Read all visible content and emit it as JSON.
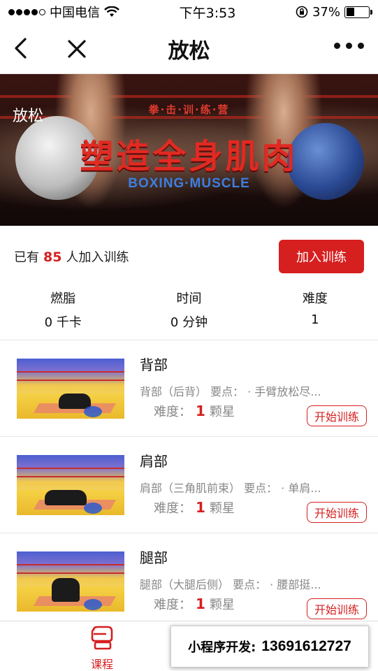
{
  "status_bar": {
    "carrier": "中国电信",
    "time": "下午3:53",
    "battery_percent": "37%",
    "battery_level": 0.37,
    "signal_icon": "signal-dots-icon",
    "wifi_icon": "wifi-icon",
    "lock_icon": "rotation-lock-icon"
  },
  "nav": {
    "title": "放松"
  },
  "banner": {
    "label": "放松",
    "subtitle": "拳·击·训·练·营",
    "headline": "塑造全身肌肉",
    "english": "BOXING·MUSCLE"
  },
  "join": {
    "prefix": "已有",
    "count": "85",
    "suffix": "人加入训练",
    "button_label": "加入训练"
  },
  "stats": [
    {
      "label": "燃脂",
      "value": "0 千卡"
    },
    {
      "label": "时间",
      "value": "0 分钟"
    },
    {
      "label": "难度",
      "value": "1"
    }
  ],
  "exercises": [
    {
      "title": "背部",
      "desc": "背部（后背） 要点： · 手臂放松尽...",
      "difficulty_prefix": "难度：",
      "difficulty": "1",
      "difficulty_suffix": "颗星",
      "button_label": "开始训练"
    },
    {
      "title": "肩部",
      "desc": "肩部（三角肌前束） 要点： · 单肩...",
      "difficulty_prefix": "难度：",
      "difficulty": "1",
      "difficulty_suffix": "颗星",
      "button_label": "开始训练"
    },
    {
      "title": "腿部",
      "desc": "腿部（大腿后侧） 要点： · 腰部挺...",
      "difficulty_prefix": "难度：",
      "difficulty": "1",
      "difficulty_suffix": "颗星",
      "button_label": "开始训练"
    }
  ],
  "tab_bar": {
    "course_label": "课程",
    "course_icon": "boxing-glove-icon",
    "promo_text": "小程序开发:",
    "promo_phone": "13691612727"
  },
  "colors": {
    "accent": "#d61f1f",
    "banner_headline": "#e02a22",
    "banner_english": "#3d7fe0"
  }
}
